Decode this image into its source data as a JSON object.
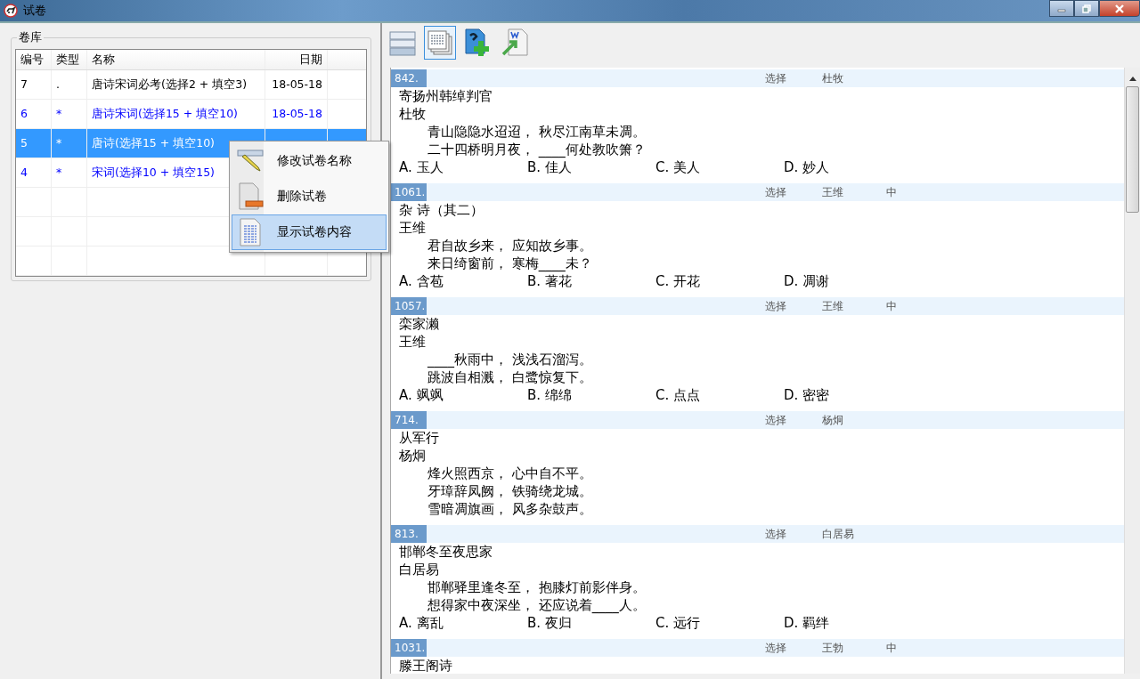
{
  "window": {
    "title": "试卷"
  },
  "library": {
    "title": "卷库",
    "columns": [
      "编号",
      "类型",
      "名称",
      "日期"
    ],
    "rows": [
      {
        "number": "7",
        "type": ".",
        "name": "唐诗宋词必考(选择2 + 填空3)",
        "date": "18-05-18",
        "color": "#000000",
        "selected": false
      },
      {
        "number": "6",
        "type": "*",
        "name": "唐诗宋词(选择15 + 填空10)",
        "date": "18-05-18",
        "color": "#0000ff",
        "selected": false
      },
      {
        "number": "5",
        "type": "*",
        "name": "唐诗(选择15 + 填空10)",
        "selected": true
      },
      {
        "number": "4",
        "type": "*",
        "name": "宋词(选择10 + 填空15)",
        "color": "#0000ff",
        "selected": false
      }
    ]
  },
  "context_menu": [
    {
      "kind": "rename",
      "label": "修改试卷名称",
      "selected": false
    },
    {
      "kind": "delete",
      "label": "删除试卷",
      "selected": false
    },
    {
      "kind": "show",
      "label": "显示试卷内容",
      "selected": true
    }
  ],
  "toolbar": [
    {
      "kind": "rows",
      "selected": false
    },
    {
      "kind": "pages",
      "selected": true
    },
    {
      "kind": "add",
      "selected": false
    },
    {
      "kind": "export",
      "selected": false
    }
  ],
  "questions": [
    {
      "number": "842.",
      "type": "选择",
      "author_tag": "杜牧",
      "title": "寄扬州韩绰判官",
      "author": "杜牧",
      "lines": [
        "青山隐隐水迢迢， 秋尽江南草未凋。",
        "二十四桥明月夜， ____何处教吹箫？"
      ],
      "options": [
        "A. 玉人",
        "B. 佳人",
        "C. 美人",
        "D. 妙人"
      ]
    },
    {
      "number": "1061.",
      "type": "选择",
      "author_tag": "王维",
      "difficulty": "中",
      "title": "杂 诗（其二）",
      "author": "王维",
      "lines": [
        "君自故乡来， 应知故乡事。",
        "来日绮窗前， 寒梅____未？"
      ],
      "options": [
        "A. 含苞",
        "B. 著花",
        "C. 开花",
        "D. 凋谢"
      ]
    },
    {
      "number": "1057.",
      "type": "选择",
      "author_tag": "王维",
      "difficulty": "中",
      "title": "栾家濑",
      "author": "王维",
      "lines": [
        "____秋雨中， 浅浅石溜泻。",
        "跳波自相溅， 白鹭惊复下。"
      ],
      "options": [
        "A. 飒飒",
        "B. 绵绵",
        "C. 点点",
        "D. 密密"
      ]
    },
    {
      "number": "714.",
      "type": "选择",
      "author_tag": "杨炯",
      "title": "从军行",
      "author": "杨炯",
      "lines": [
        "烽火照西京， 心中自不平。",
        "牙璋辞凤阙， 铁骑绕龙城。",
        "雪暗凋旗画， 风多杂鼓声。"
      ]
    },
    {
      "number": "813.",
      "type": "选择",
      "author_tag": "白居易",
      "title": "邯郸冬至夜思家",
      "author": "白居易",
      "lines": [
        "邯郸驿里逢冬至， 抱膝灯前影伴身。",
        "想得家中夜深坐， 还应说着____人。"
      ],
      "options": [
        "A. 离乱",
        "B. 夜归",
        "C. 远行",
        "D. 羁绊"
      ]
    },
    {
      "number": "1031.",
      "type": "选择",
      "author_tag": "王勃",
      "difficulty": "中",
      "title": "滕王阁诗"
    }
  ]
}
